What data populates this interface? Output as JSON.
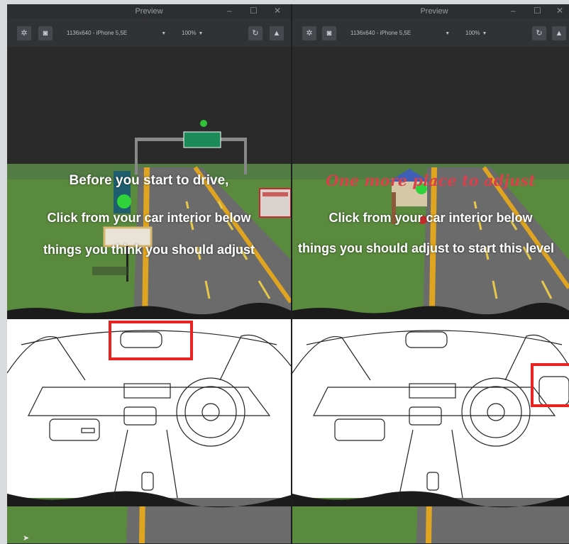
{
  "windows": [
    {
      "title": "Preview",
      "device": "1136x640 - iPhone 5,5E",
      "zoom": "100%",
      "headline": "",
      "lines": [
        "Before you start to drive,",
        "Click from your car interior below",
        "things you think you should adjust"
      ]
    },
    {
      "title": "Preview",
      "device": "1136x640 - iPhone 5,5E",
      "zoom": "100%",
      "headline": "One more place to adjust",
      "lines": [
        "Click from your car interior below",
        "things you should adjust to start this level"
      ]
    }
  ],
  "icons": {
    "debug": "bug-icon",
    "screenshot": "camera-icon",
    "reload": "refresh-icon",
    "warning": "warning-icon"
  },
  "colors": {
    "highlight": "#e8231f",
    "sky": "#2a2a2a",
    "grass": "#5a8a3e",
    "road": "#6a6a6a",
    "lane_yellow": "#e0a520",
    "headline": "#d4434c"
  }
}
